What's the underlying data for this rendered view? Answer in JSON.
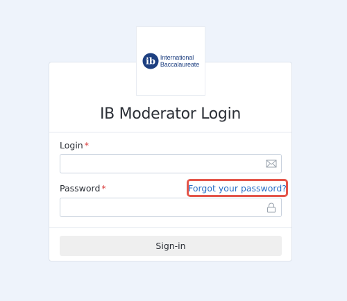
{
  "logo": {
    "line1": "International",
    "line2": "Baccalaureate",
    "mark_letters": "ib",
    "brand_color": "#1d3f80"
  },
  "form": {
    "title": "IB Moderator Login",
    "login_label": "Login",
    "login_required": "*",
    "login_value": "",
    "login_icon": "envelope-icon",
    "password_label": "Password",
    "password_required": "*",
    "password_value": "",
    "password_icon": "lock-icon",
    "forgot_link": "Forgot your password?",
    "signin_button": "Sign-in"
  },
  "colors": {
    "background": "#eef3fb",
    "link": "#2a6fc6",
    "highlight_border": "#e4564b",
    "required": "#d93a3a"
  }
}
